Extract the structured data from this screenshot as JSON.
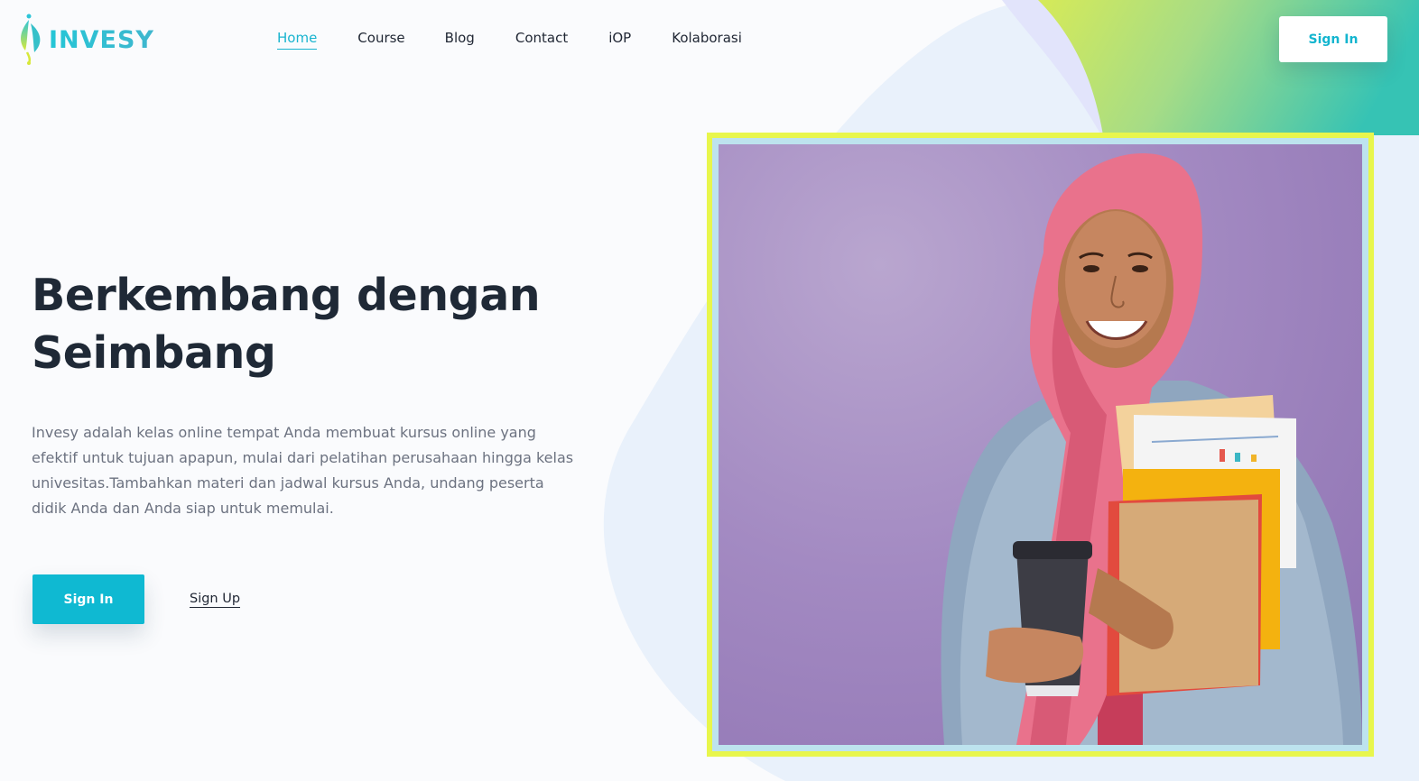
{
  "brand": {
    "name": "INVESY",
    "logo_icon": "drop-leaf-icon",
    "colors": {
      "accent": "#0fb9d2",
      "frame": "#e8f64c",
      "heading": "#1f2936",
      "body_text": "#6c7280"
    }
  },
  "nav": {
    "items": [
      {
        "label": "Home",
        "active": true
      },
      {
        "label": "Course",
        "active": false
      },
      {
        "label": "Blog",
        "active": false
      },
      {
        "label": "Contact",
        "active": false
      },
      {
        "label": "iOP",
        "active": false
      },
      {
        "label": "Kolaborasi",
        "active": false
      }
    ]
  },
  "header": {
    "signin_label": "Sign In"
  },
  "hero": {
    "title_line1": "Berkembang dengan",
    "title_line2": "Seimbang",
    "description": "Invesy adalah kelas online tempat Anda membuat kursus online yang efektif untuk tujuan apapun, mulai dari pelatihan perusahaan hingga kelas univesitas.Tambahkan materi dan jadwal kursus Anda, undang peserta didik Anda dan Anda siap untuk memulai.",
    "signin_label": "Sign In",
    "signup_label": "Sign Up"
  }
}
